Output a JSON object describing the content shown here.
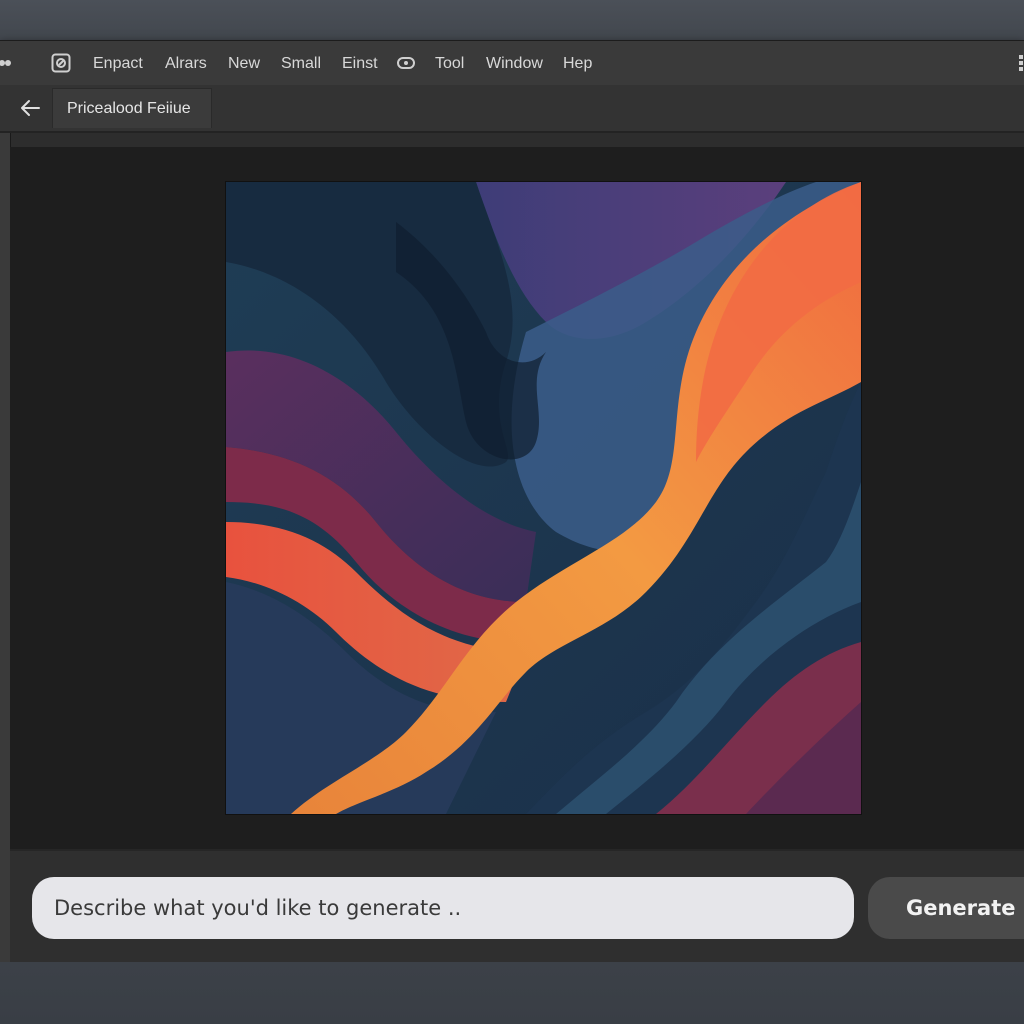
{
  "menubar": {
    "items": [
      {
        "label": "Enpact"
      },
      {
        "label": "Alrars"
      },
      {
        "label": "New"
      },
      {
        "label": "Small"
      },
      {
        "label": "Einst"
      },
      {
        "label": "Tool"
      },
      {
        "label": "Window"
      },
      {
        "label": "Hep"
      }
    ],
    "icons": [
      "app-icon",
      "photo-edit-icon",
      "cloud-link-icon",
      "more-icon"
    ]
  },
  "tabbar": {
    "back_icon": "arrow-left-icon",
    "tab_title": "Pricealood Feiiue"
  },
  "prompt": {
    "placeholder": "Describe what you'd like to generate ..",
    "value": "",
    "generate_label": "Generate"
  },
  "colors": {
    "accent_orange": "#f2913e",
    "accent_red": "#e5553e",
    "deep_blue": "#1e3750",
    "purple": "#4b2f5e",
    "window_bg": "#2d2d2d"
  }
}
